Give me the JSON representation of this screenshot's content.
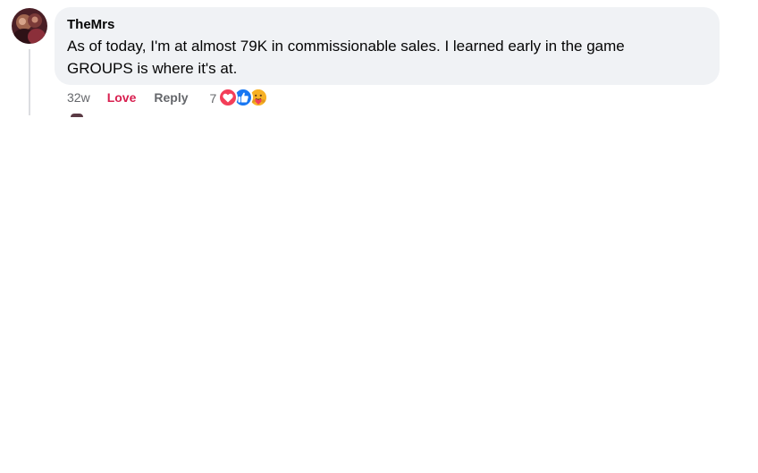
{
  "comment": {
    "author": "TheMrs",
    "text_line1": "As of today, I'm at almost 79K in commissionable sales. I learned early in the game",
    "text_line2": "GROUPS is where it's at.",
    "timestamp": "32w",
    "reacted_label": "Love",
    "reply_label": "Reply",
    "reaction_count": "7",
    "reaction_types": [
      "love",
      "like",
      "care"
    ],
    "reaction_colors": {
      "love": "#f33e58",
      "like": "#1877f2",
      "care": "#f7b125"
    },
    "love_label_color": "#d81f4f"
  }
}
